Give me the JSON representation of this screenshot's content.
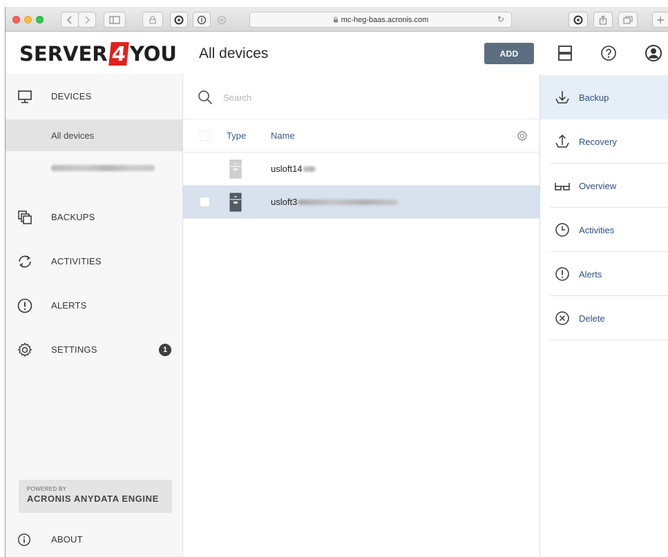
{
  "browser": {
    "url": "mc-heg-baas.acronis.com"
  },
  "header": {
    "logo_left": "SERVER",
    "logo_mid": "4",
    "logo_right": "YOU",
    "title": "All devices",
    "add_label": "ADD"
  },
  "sidebar": {
    "devices_label": "DEVICES",
    "all_devices_label": "All devices",
    "backups_label": "BACKUPS",
    "activities_label": "ACTIVITIES",
    "alerts_label": "ALERTS",
    "settings_label": "SETTINGS",
    "settings_badge": "1",
    "powered_by": "POWERED BY",
    "engine": "ACRONIS ANYDATA ENGINE",
    "about_label": "ABOUT"
  },
  "main": {
    "search_placeholder": "Search",
    "columns": {
      "type": "Type",
      "name": "Name"
    },
    "rows": [
      {
        "name": "usloft14",
        "selected": false
      },
      {
        "name": "usloft3",
        "selected": true
      }
    ]
  },
  "actions": {
    "items": [
      {
        "label": "Backup",
        "icon": "backup-icon"
      },
      {
        "label": "Recovery",
        "icon": "recovery-icon"
      },
      {
        "label": "Overview",
        "icon": "glasses-icon"
      },
      {
        "label": "Activities",
        "icon": "clock-icon"
      },
      {
        "label": "Alerts",
        "icon": "alert-icon"
      },
      {
        "label": "Delete",
        "icon": "delete-icon"
      }
    ]
  },
  "colors": {
    "brand_red": "#e2211c",
    "add_button": "#5a6e80",
    "link_blue": "#2c4f82",
    "selected_row": "#d8e1ee"
  }
}
